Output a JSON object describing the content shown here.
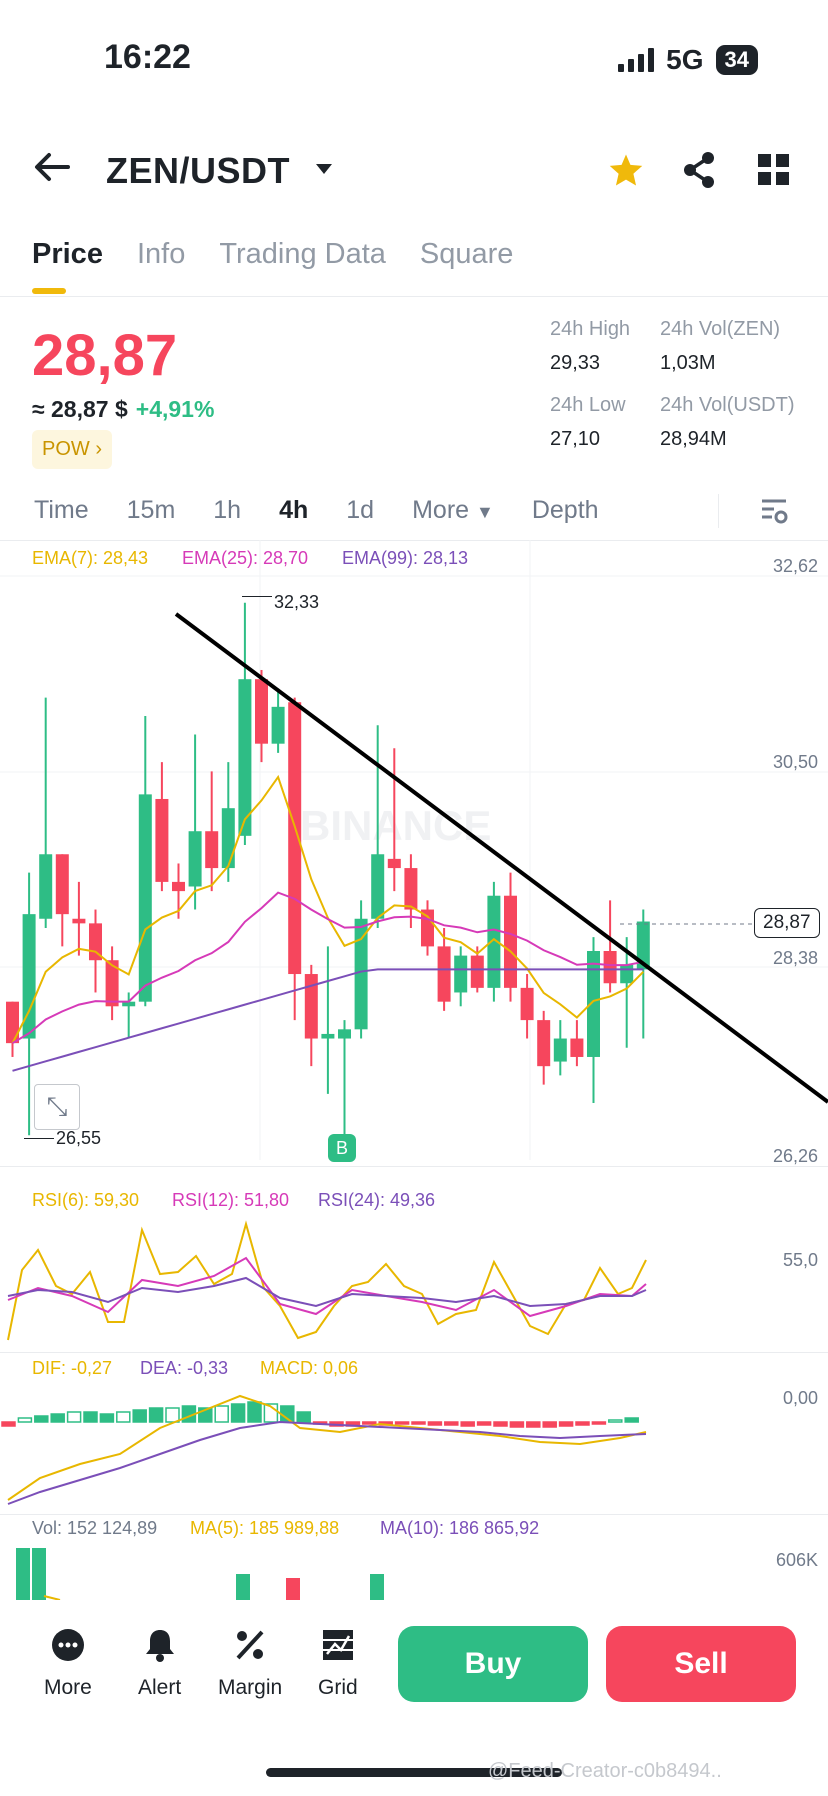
{
  "status": {
    "time": "16:22",
    "network": "5G",
    "battery": "34"
  },
  "header": {
    "pair": "ZEN/USDT"
  },
  "tabs": [
    "Price",
    "Info",
    "Trading Data",
    "Square"
  ],
  "price": {
    "last": "28,87",
    "usd": "≈ 28,87 $",
    "change": "+4,91%",
    "tag": "POW"
  },
  "stats": {
    "high_label": "24h High",
    "high": "29,33",
    "vol_base_label": "24h Vol(ZEN)",
    "vol_base": "1,03M",
    "low_label": "24h Low",
    "low": "27,10",
    "vol_quote_label": "24h Vol(USDT)",
    "vol_quote": "28,94M"
  },
  "timeframes": [
    "Time",
    "15m",
    "1h",
    "4h",
    "1d",
    "More",
    "Depth"
  ],
  "active_timeframe": "4h",
  "ema": {
    "ema7": "EMA(7): 28,43",
    "ema25": "EMA(25): 28,70",
    "ema99": "EMA(99): 28,13"
  },
  "price_axis": [
    "32,62",
    "30,50",
    "28,38",
    "26,26"
  ],
  "current_price_tag": "28,87",
  "annotations": {
    "high": "32,33",
    "low": "26,55",
    "buy_marker": "B"
  },
  "watermark": "BINANCE",
  "rsi": {
    "r6": "RSI(6): 59,30",
    "r12": "RSI(12): 51,80",
    "r24": "RSI(24): 49,36",
    "axis": "55,0"
  },
  "macd": {
    "dif": "DIF: -0,27",
    "dea": "DEA: -0,33",
    "macd": "MACD: 0,06",
    "axis": "0,00"
  },
  "volume": {
    "vol": "Vol: 152 124,89",
    "ma5": "MA(5): 185 989,88",
    "ma10": "MA(10): 186 865,92",
    "axis": "606K"
  },
  "bottom_nav": {
    "more": "More",
    "alert": "Alert",
    "margin": "Margin",
    "grid": "Grid",
    "buy": "Buy",
    "sell": "Sell"
  },
  "footer_watermark": "@Feed-Creator-c0b8494..",
  "colors": {
    "up": "#2EBD85",
    "down": "#F6465D",
    "accent": "#F0B90B",
    "ema7": "#E8B700",
    "ema25": "#D63AB8",
    "ema99": "#7B4FB8"
  },
  "chart_data": {
    "type": "candlestick",
    "ylim": [
      26.26,
      32.62
    ],
    "candles": [
      {
        "o": 28.0,
        "h": 28.0,
        "l": 27.4,
        "c": 27.55
      },
      {
        "o": 27.6,
        "h": 29.4,
        "l": 26.55,
        "c": 28.95
      },
      {
        "o": 28.9,
        "h": 31.3,
        "l": 28.8,
        "c": 29.6
      },
      {
        "o": 29.6,
        "h": 29.6,
        "l": 28.6,
        "c": 28.95
      },
      {
        "o": 28.9,
        "h": 29.3,
        "l": 28.5,
        "c": 28.85
      },
      {
        "o": 28.85,
        "h": 29.0,
        "l": 28.1,
        "c": 28.45
      },
      {
        "o": 28.45,
        "h": 28.6,
        "l": 27.8,
        "c": 27.95
      },
      {
        "o": 27.95,
        "h": 28.1,
        "l": 27.6,
        "c": 28.0
      },
      {
        "o": 28.0,
        "h": 31.1,
        "l": 27.95,
        "c": 30.25
      },
      {
        "o": 30.2,
        "h": 30.6,
        "l": 29.2,
        "c": 29.3
      },
      {
        "o": 29.3,
        "h": 29.5,
        "l": 28.9,
        "c": 29.2
      },
      {
        "o": 29.25,
        "h": 30.9,
        "l": 29.0,
        "c": 29.85
      },
      {
        "o": 29.85,
        "h": 30.5,
        "l": 29.2,
        "c": 29.45
      },
      {
        "o": 29.45,
        "h": 30.6,
        "l": 29.3,
        "c": 30.1
      },
      {
        "o": 29.8,
        "h": 32.33,
        "l": 29.7,
        "c": 31.5
      },
      {
        "o": 31.5,
        "h": 31.6,
        "l": 30.6,
        "c": 30.8
      },
      {
        "o": 30.8,
        "h": 31.4,
        "l": 30.7,
        "c": 31.2
      },
      {
        "o": 31.25,
        "h": 31.3,
        "l": 27.8,
        "c": 28.3
      },
      {
        "o": 28.3,
        "h": 28.4,
        "l": 27.3,
        "c": 27.6
      },
      {
        "o": 27.6,
        "h": 28.6,
        "l": 27.0,
        "c": 27.65
      },
      {
        "o": 27.6,
        "h": 27.8,
        "l": 26.55,
        "c": 27.7
      },
      {
        "o": 27.7,
        "h": 29.1,
        "l": 27.6,
        "c": 28.9
      },
      {
        "o": 28.9,
        "h": 31.0,
        "l": 28.8,
        "c": 29.6
      },
      {
        "o": 29.55,
        "h": 30.75,
        "l": 29.2,
        "c": 29.45
      },
      {
        "o": 29.45,
        "h": 29.6,
        "l": 28.8,
        "c": 29.0
      },
      {
        "o": 29.0,
        "h": 29.1,
        "l": 28.5,
        "c": 28.6
      },
      {
        "o": 28.6,
        "h": 28.8,
        "l": 27.9,
        "c": 28.0
      },
      {
        "o": 28.1,
        "h": 28.6,
        "l": 27.95,
        "c": 28.5
      },
      {
        "o": 28.5,
        "h": 28.6,
        "l": 28.1,
        "c": 28.15
      },
      {
        "o": 28.15,
        "h": 29.3,
        "l": 28.0,
        "c": 29.15
      },
      {
        "o": 29.15,
        "h": 29.4,
        "l": 28.0,
        "c": 28.15
      },
      {
        "o": 28.15,
        "h": 28.3,
        "l": 27.6,
        "c": 27.8
      },
      {
        "o": 27.8,
        "h": 27.9,
        "l": 27.1,
        "c": 27.3
      },
      {
        "o": 27.35,
        "h": 27.8,
        "l": 27.2,
        "c": 27.6
      },
      {
        "o": 27.6,
        "h": 27.8,
        "l": 27.3,
        "c": 27.4
      },
      {
        "o": 27.4,
        "h": 28.7,
        "l": 26.9,
        "c": 28.55
      },
      {
        "o": 28.55,
        "h": 29.1,
        "l": 28.1,
        "c": 28.2
      },
      {
        "o": 28.2,
        "h": 28.7,
        "l": 27.5,
        "c": 28.4
      },
      {
        "o": 28.35,
        "h": 29.0,
        "l": 27.6,
        "c": 28.87
      }
    ]
  }
}
